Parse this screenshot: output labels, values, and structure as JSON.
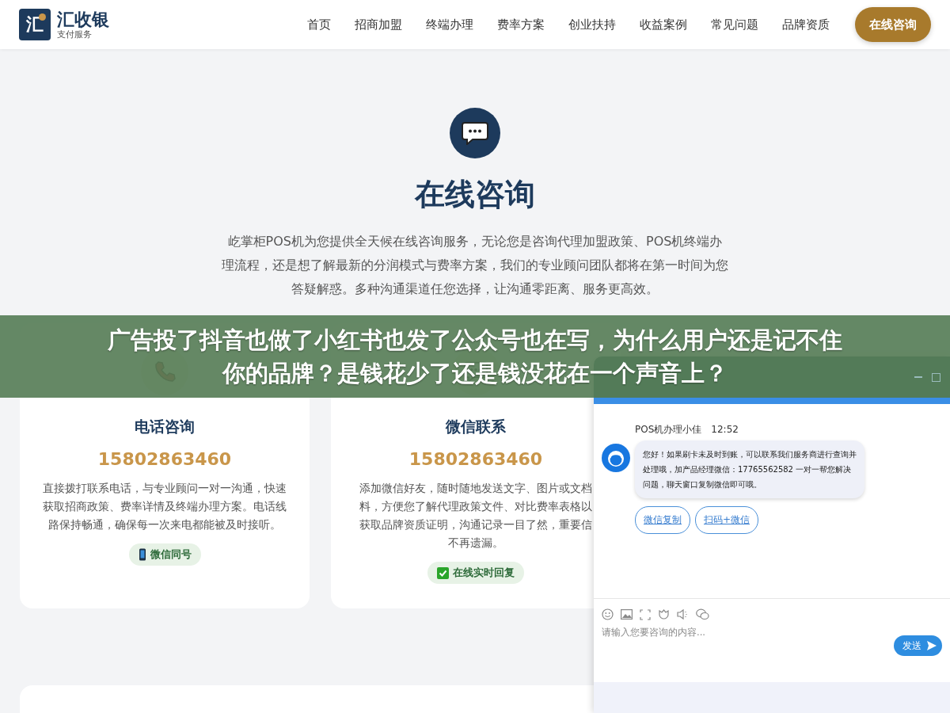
{
  "header": {
    "logo": {
      "mark": "汇",
      "name": "汇收银",
      "tagline": "支付服务"
    },
    "nav": [
      {
        "label": "首页"
      },
      {
        "label": "招商加盟"
      },
      {
        "label": "终端办理"
      },
      {
        "label": "费率方案"
      },
      {
        "label": "创业扶持"
      },
      {
        "label": "收益案例"
      },
      {
        "label": "常见问题"
      },
      {
        "label": "品牌资质"
      }
    ],
    "cta": "在线咨询"
  },
  "hero": {
    "title": "在线咨询",
    "description": "屹掌柜POS机为您提供全天候在线咨询服务，无论您是咨询代理加盟政策、POS机终端办理流程，还是想了解最新的分润模式与费率方案，我们的专业顾问团队都将在第一时间为您答疑解惑。多种沟通渠道任您选择，让沟通零距离、服务更高效。"
  },
  "cards": [
    {
      "kind": "phone",
      "title": "电话咨询",
      "number": "15802863460",
      "description_lines": [
        "直接拨打联系电话，与专业顾问一对一沟通，快速",
        "获取招商政策、费率详情及终端办理方案。电话线",
        "路保持畅通，确保每一次来电都能被及时接听。"
      ],
      "badge": {
        "kind": "mobile",
        "label": "微信同号"
      }
    },
    {
      "kind": "chat",
      "title": "微信联系",
      "number": "15802863460",
      "description_lines": [
        "添加微信好友，随时随地发送文字、图片或文档",
        "料，方便您了解代理政策文件、对比费率表格以",
        "获取品牌资质证明，沟通记录一目了然，重要信",
        "不再遗漏。"
      ],
      "badge": {
        "kind": "check",
        "label": "在线实时回复"
      }
    }
  ],
  "chat_window": {
    "message": {
      "sender": "POS机办理小佳",
      "time": "12:52",
      "text": "您好！如果刷卡未及时到账，可以联系我们服务商进行查询并处理哦，加产品经理微信：17765562582 一对一帮您解决问题，聊天窗口复制微信即可哦。"
    },
    "actions": [
      {
        "label": "微信复制"
      },
      {
        "label": "扫码+微信"
      }
    ],
    "input": {
      "placeholder": "请输入您要咨询的内容..."
    },
    "send": "发送"
  },
  "overlay_banner": {
    "lines": [
      "广告投了抖音也做了小红书也发了公众号也在写，为什么用户还是记不住",
      "你的品牌？是钱花少了还是钱没花在一个声音上？"
    ]
  }
}
